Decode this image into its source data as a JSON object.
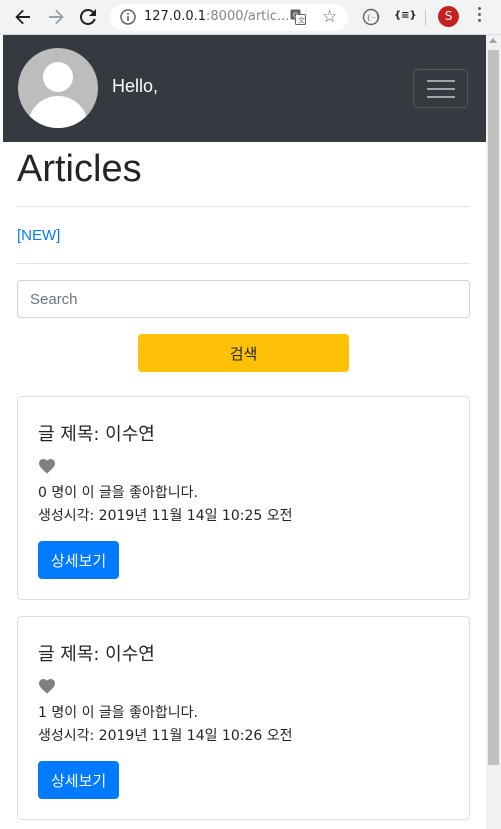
{
  "browser": {
    "url_host": "127.0.0.1",
    "url_rest": ":8000/artic...",
    "profile_initial": "S",
    "ext_label": "{≡}"
  },
  "navbar": {
    "greeting": "Hello,"
  },
  "page": {
    "title": "Articles",
    "new_link": "[NEW]"
  },
  "search": {
    "placeholder": "Search",
    "button_label": "검색"
  },
  "articles": [
    {
      "title": "글 제목: 이수연",
      "likes_text": "0 명이 이 글을 좋아합니다.",
      "created_text": "생성시각: 2019년 11월 14일 10:25 오전",
      "button_label": "상세보기"
    },
    {
      "title": "글 제목: 이수연",
      "likes_text": "1 명이 이 글을 좋아합니다.",
      "created_text": "생성시각: 2019년 11월 14일 10:26 오전",
      "button_label": "상세보기"
    }
  ],
  "icons": {
    "heart": "heart-icon",
    "avatar": "default-avatar-icon"
  },
  "colors": {
    "navbar_bg": "#343a40",
    "search_button": "#ffc107",
    "primary": "#007bff",
    "heart": "#808080"
  }
}
